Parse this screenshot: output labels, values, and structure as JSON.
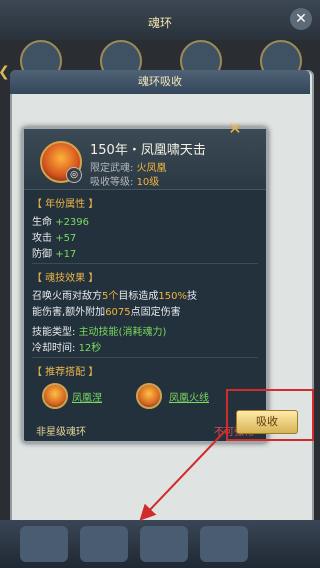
{
  "background": {
    "title": "魂环",
    "panel_title": "魂环吸收"
  },
  "popup": {
    "header": {
      "title": "150年・凤凰啸天击",
      "limit_label": "限定武魂:",
      "limit_value": "火凤凰",
      "level_label": "吸收等级:",
      "level_value": "10级"
    },
    "attributes": {
      "section_title": "【 年份属性 】",
      "rows": [
        {
          "label": "生命",
          "value": "+2396"
        },
        {
          "label": "攻击",
          "value": "+57"
        },
        {
          "label": "防御",
          "value": "+17"
        }
      ]
    },
    "skill": {
      "section_title": "【 魂技效果 】",
      "desc_part1": "召唤火雨对敌方",
      "desc_target": "5个",
      "desc_part2": "目标造成",
      "desc_percent": "150%",
      "desc_part3": "技",
      "desc_line2_part1": "能伤害,额外附加",
      "desc_extra": "6075",
      "desc_line2_part2": "点固定伤害",
      "type_label": "技能类型:",
      "type_value": "主动技能(消耗魂力)",
      "cooldown_label": "冷却时间:",
      "cooldown_value": "12秒"
    },
    "recommend": {
      "section_title": "【 推荐搭配 】",
      "items": [
        {
          "label": "凤凰涅"
        },
        {
          "label": "凤凰火线"
        }
      ]
    },
    "footer_left": "非星级魂环",
    "footer_right": "不可强化",
    "absorb_button": "吸收"
  },
  "colors": {
    "accent_gold": "#f0b53c",
    "highlight_red": "#d12b2b",
    "text_green": "#7adb5f"
  }
}
